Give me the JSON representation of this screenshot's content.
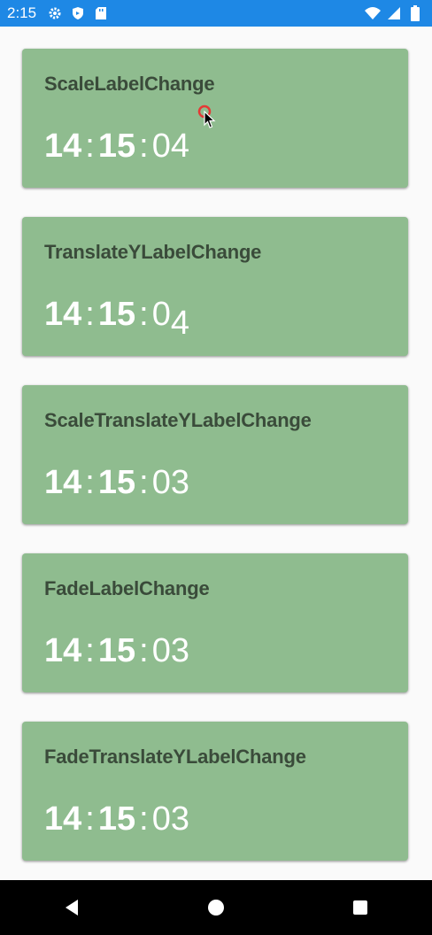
{
  "status_bar": {
    "time": "2:15",
    "left_icons": [
      "gear-icon",
      "shield-icon",
      "sd-card-icon"
    ],
    "right_icons": [
      "wifi-icon",
      "signal-icon",
      "battery-icon"
    ],
    "color": "#1e88e5"
  },
  "cards": [
    {
      "title": "ScaleLabelChange",
      "hours": "14",
      "minutes": "15",
      "sec_d1": "0",
      "sec_d2": "4"
    },
    {
      "title": "TranslateYLabelChange",
      "hours": "14",
      "minutes": "15",
      "sec_d1": "0",
      "sec_d2": "4"
    },
    {
      "title": "ScaleTranslateYLabelChange",
      "hours": "14",
      "minutes": "15",
      "sec_d1": "0",
      "sec_d2": "3"
    },
    {
      "title": "FadeLabelChange",
      "hours": "14",
      "minutes": "15",
      "sec_d1": "0",
      "sec_d2": "3"
    },
    {
      "title": "FadeTranslateYLabelChange",
      "hours": "14",
      "minutes": "15",
      "sec_d1": "0",
      "sec_d2": "3"
    }
  ],
  "separator": ":",
  "card_color": "#8fbc8f",
  "nav_bar": {
    "buttons": [
      "back-icon",
      "home-icon",
      "recents-icon"
    ]
  }
}
